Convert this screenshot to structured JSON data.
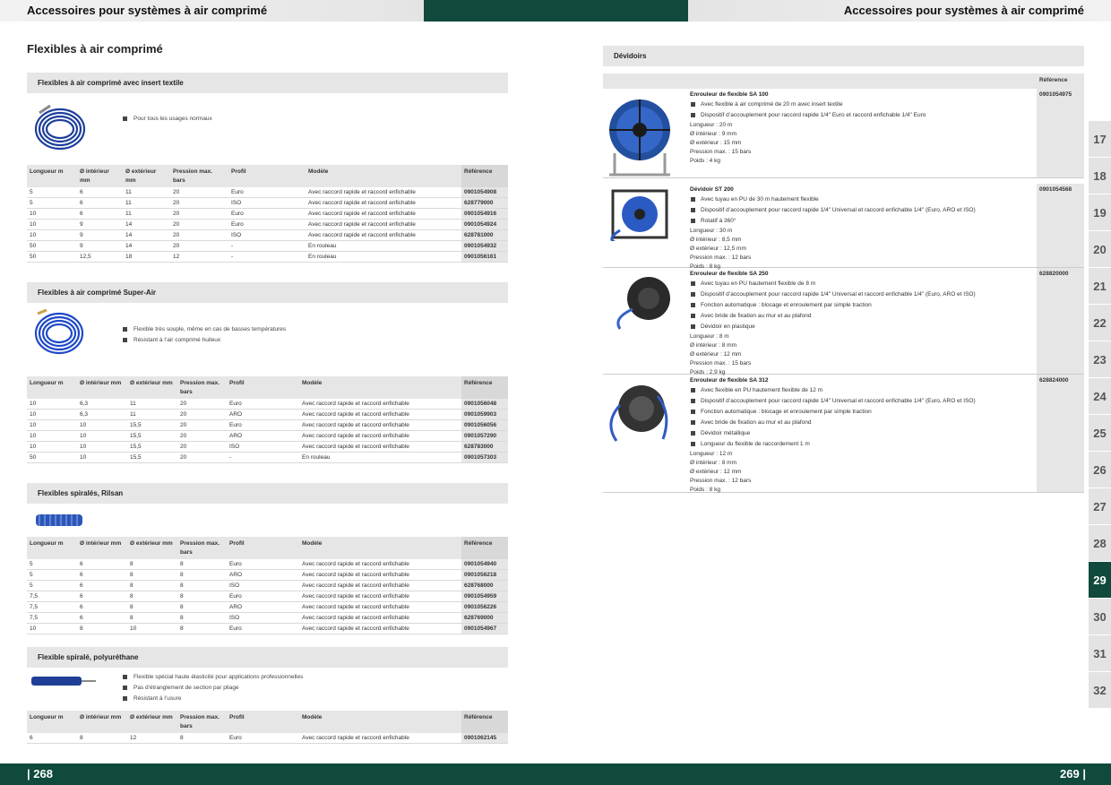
{
  "header": {
    "left_title": "Accessoires pour systèmes à air comprimé",
    "right_title": "Accessoires pour systèmes à air comprimé"
  },
  "page_title": "Flexibles à air comprimé",
  "footer": {
    "left_page": "| 268",
    "right_page": "269 |"
  },
  "cols": [
    "Longueur m",
    "Ø intérieur mm",
    "Ø extérieur mm",
    "Pression max. bars",
    "Profil",
    "Modèle",
    "Référence"
  ],
  "sections": [
    {
      "title": "Flexibles à air comprimé avec insert textile",
      "bullets": [
        "Pour tous les usages normaux"
      ],
      "rows": [
        [
          "5",
          "6",
          "11",
          "20",
          "Euro",
          "Avec raccord rapide et raccord enfichable",
          "0901054908"
        ],
        [
          "5",
          "6",
          "11",
          "20",
          "ISO",
          "Avec raccord rapide et raccord enfichable",
          "628779000"
        ],
        [
          "10",
          "6",
          "11",
          "20",
          "Euro",
          "Avec raccord rapide et raccord enfichable",
          "0901054916"
        ],
        [
          "10",
          "9",
          "14",
          "20",
          "Euro",
          "Avec raccord rapide et raccord enfichable",
          "0901054924"
        ],
        [
          "10",
          "9",
          "14",
          "20",
          "ISO",
          "Avec raccord rapide et raccord enfichable",
          "628781000"
        ],
        [
          "50",
          "9",
          "14",
          "20",
          "-",
          "En rouleau",
          "0901054932"
        ],
        [
          "50",
          "12,5",
          "18",
          "12",
          "-",
          "En rouleau",
          "0901056161"
        ]
      ]
    },
    {
      "title": "Flexibles à air comprimé Super-Air",
      "bullets": [
        "Flexible très souple, même en cas de basses températures",
        "Résistant à l’air comprimé huileux"
      ],
      "rows": [
        [
          "10",
          "6,3",
          "11",
          "20",
          "Euro",
          "Avec raccord rapide et raccord enfichable",
          "0901056048"
        ],
        [
          "10",
          "6,3",
          "11",
          "20",
          "ARO",
          "Avec raccord rapide et raccord enfichable",
          "0901059903"
        ],
        [
          "10",
          "10",
          "15,5",
          "20",
          "Euro",
          "Avec raccord rapide et raccord enfichable",
          "0901056056"
        ],
        [
          "10",
          "10",
          "15,5",
          "20",
          "ARO",
          "Avec raccord rapide et raccord enfichable",
          "0901057290"
        ],
        [
          "10",
          "10",
          "15,5",
          "20",
          "ISO",
          "Avec raccord rapide et raccord enfichable",
          "628783000"
        ],
        [
          "50",
          "10",
          "15,5",
          "20",
          "-",
          "En rouleau",
          "0901057303"
        ]
      ]
    },
    {
      "title": "Flexibles spiralés, Rilsan",
      "bullets": [],
      "rows": [
        [
          "5",
          "6",
          "8",
          "8",
          "Euro",
          "Avec raccord rapide et raccord enfichable",
          "0901054940"
        ],
        [
          "5",
          "6",
          "8",
          "8",
          "ARO",
          "Avec raccord rapide et raccord enfichable",
          "0901056218"
        ],
        [
          "5",
          "6",
          "8",
          "8",
          "ISO",
          "Avec raccord rapide et raccord enfichable",
          "628768000"
        ],
        [
          "7,5",
          "6",
          "8",
          "8",
          "Euro",
          "Avec raccord rapide et raccord enfichable",
          "0901054959"
        ],
        [
          "7,5",
          "6",
          "8",
          "8",
          "ARO",
          "Avec raccord rapide et raccord enfichable",
          "0901056226"
        ],
        [
          "7,5",
          "6",
          "8",
          "8",
          "ISO",
          "Avec raccord rapide et raccord enfichable",
          "628769000"
        ],
        [
          "10",
          "8",
          "10",
          "8",
          "Euro",
          "Avec raccord rapide et raccord enfichable",
          "0901054967"
        ]
      ]
    },
    {
      "title": "Flexible spiralé, polyuréthane",
      "bullets": [
        "Flexible spécial haute élasticité pour applications professionnelles",
        "Pas d'étranglement de section par pliage",
        "Résistant à l’usure"
      ],
      "rows": [
        [
          "6",
          "8",
          "12",
          "8",
          "Euro",
          "Avec raccord rapide et raccord enfichable",
          "0901062145"
        ]
      ]
    }
  ],
  "devidoirs": {
    "title": "Dévidoirs",
    "ref_header": "Référence",
    "items": [
      {
        "name": "Enrouleur de flexible SA 100",
        "ref": "0901054975",
        "bullets": [
          "Avec flexible à air comprimé de 20 m avec insert textile",
          "Dispositif d’accouplement pour raccord rapide 1/4\" Euro et raccord enfichable 1/4\" Euro"
        ],
        "specs": [
          "Longueur : 20 m",
          "Ø intérieur : 9 mm",
          "Ø extérieur : 15 mm",
          "Pression max. : 15 bars",
          "Poids : 4 kg"
        ]
      },
      {
        "name": "Dévidoir ST 200",
        "ref": "0901054568",
        "bullets": [
          "Avec tuyau en PU de 30 m hautement flexible",
          "Dispositif d’accouplement pour raccord rapide 1/4\" Universal et raccord enfichable 1/4\" (Euro, ARO et ISO)",
          "Rotatif à 360°"
        ],
        "specs": [
          "Longueur : 30 m",
          "Ø intérieur : 8,5 mm",
          "Ø extérieur : 12,5 mm",
          "Pression max. : 12 bars",
          "Poids : 8 kg"
        ]
      },
      {
        "name": "Enrouleur de flexible SA 250",
        "ref": "628820000",
        "bullets": [
          "Avec tuyau en PU hautement flexible de 8 m",
          "Dispositif d’accouplement pour raccord rapide 1/4\" Universal et raccord enfichable 1/4\" (Euro, ARO et ISO)",
          "Fonction automatique : blocage et enroulement par simple traction",
          "Avec bride de fixation au mur et au plafond",
          "Dévidoir en plastique"
        ],
        "specs": [
          "Longueur : 8 m",
          "Ø intérieur : 8 mm",
          "Ø extérieur : 12 mm",
          "Pression max. : 15 bars",
          "Poids : 2,9 kg"
        ]
      },
      {
        "name": "Enrouleur de flexible SA 312",
        "ref": "628824000",
        "bullets": [
          "Avec flexible en PU hautement flexible de 12 m",
          "Dispositif d’accouplement pour raccord rapide 1/4\" Universal et raccord enfichable 1/4\" (Euro, ARO et ISO)",
          "Fonction automatique : blocage et enroulement par simple traction",
          "Avec bride de fixation au mur et au plafond",
          "Dévidoir métallique",
          "Longueur du flexible de raccordement 1 m"
        ],
        "specs": [
          "Longueur : 12 m",
          "Ø intérieur : 8 mm",
          "Ø extérieur : 12 mm",
          "Pression max. : 12 bars",
          "Poids : 8 kg"
        ]
      }
    ]
  },
  "tabs": [
    "17",
    "18",
    "19",
    "20",
    "21",
    "22",
    "23",
    "24",
    "25",
    "26",
    "27",
    "28",
    "29",
    "30",
    "31",
    "32"
  ],
  "active_tab": "29"
}
